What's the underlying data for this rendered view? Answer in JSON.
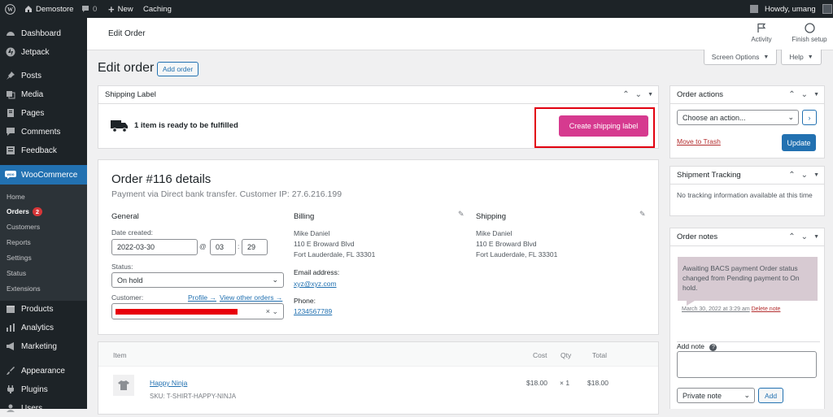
{
  "adminbar": {
    "site_name": "Demostore",
    "comments_count": "0",
    "new_label": "New",
    "caching_label": "Caching",
    "howdy": "Howdy, umang"
  },
  "sidebar": {
    "items": [
      {
        "label": "Dashboard",
        "icon": "dashboard-icon"
      },
      {
        "label": "Jetpack",
        "icon": "jetpack-icon"
      },
      {
        "label": "Posts",
        "icon": "pin-icon"
      },
      {
        "label": "Media",
        "icon": "media-icon"
      },
      {
        "label": "Pages",
        "icon": "pages-icon"
      },
      {
        "label": "Comments",
        "icon": "comment-icon"
      },
      {
        "label": "Feedback",
        "icon": "feedback-icon"
      },
      {
        "label": "WooCommerce",
        "icon": "woo-icon"
      },
      {
        "label": "Products",
        "icon": "products-icon"
      },
      {
        "label": "Analytics",
        "icon": "analytics-icon"
      },
      {
        "label": "Marketing",
        "icon": "megaphone-icon"
      },
      {
        "label": "Appearance",
        "icon": "brush-icon"
      },
      {
        "label": "Plugins",
        "icon": "plugin-icon"
      },
      {
        "label": "Users",
        "icon": "users-icon"
      }
    ],
    "submenu": [
      "Home",
      "Orders",
      "Customers",
      "Reports",
      "Settings",
      "Status",
      "Extensions"
    ],
    "orders_badge": "2"
  },
  "header": {
    "title": "Edit Order",
    "activity_label": "Activity",
    "finish_setup_label": "Finish setup",
    "screen_options_label": "Screen Options",
    "help_label": "Help"
  },
  "page": {
    "title": "Edit order",
    "add_order_label": "Add order"
  },
  "shipping_label": {
    "title": "Shipping Label",
    "message": "1 item is ready to be fulfilled",
    "button_label": "Create shipping label"
  },
  "order": {
    "title": "Order #116 details",
    "subtitle": "Payment via Direct bank transfer. Customer IP: 27.6.216.199",
    "general_heading": "General",
    "date_created_label": "Date created:",
    "date_value": "2022-03-30",
    "at_symbol": "@",
    "hour_value": "03",
    "minute_value": "29",
    "time_colon": ":",
    "status_label": "Status:",
    "status_value": "On hold",
    "customer_label": "Customer:",
    "profile_link": "Profile →",
    "view_orders_link": "View other orders →",
    "billing_heading": "Billing",
    "billing_address": [
      "Mike Daniel",
      "110 E Broward Blvd",
      "Fort Lauderdale, FL 33301"
    ],
    "email_label": "Email address:",
    "email_value": "xyz@xyz.com",
    "phone_label": "Phone:",
    "phone_value": "1234567789",
    "shipping_heading": "Shipping",
    "shipping_address": [
      "Mike Daniel",
      "110 E Broward Blvd",
      "Fort Lauderdale, FL 33301"
    ]
  },
  "items": {
    "headers": {
      "item": "Item",
      "cost": "Cost",
      "qty": "Qty",
      "total": "Total"
    },
    "rows": [
      {
        "name": "Happy Ninja",
        "sku": "SKU: T-SHIRT-HAPPY-NINJA",
        "cost": "$18.00",
        "qty": "× 1",
        "total": "$18.00"
      }
    ]
  },
  "order_actions": {
    "title": "Order actions",
    "select_value": "Choose an action...",
    "move_to_trash": "Move to Trash",
    "update_label": "Update"
  },
  "shipment_tracking": {
    "title": "Shipment Tracking",
    "message": "No tracking information available at this time"
  },
  "order_notes": {
    "title": "Order notes",
    "note_text": "Awaiting BACS payment Order status changed from Pending payment to On hold.",
    "note_date": "March 30, 2022 at 3:29 am",
    "delete_label": "Delete note",
    "add_note_label": "Add note",
    "note_type_value": "Private note",
    "add_button_label": "Add"
  },
  "colors": {
    "wp_dark": "#1d2327",
    "wp_blue": "#2271b1",
    "woo_pink": "#d63a8f",
    "highlight_red": "#e2000f",
    "note_bg": "#d7cad2"
  }
}
